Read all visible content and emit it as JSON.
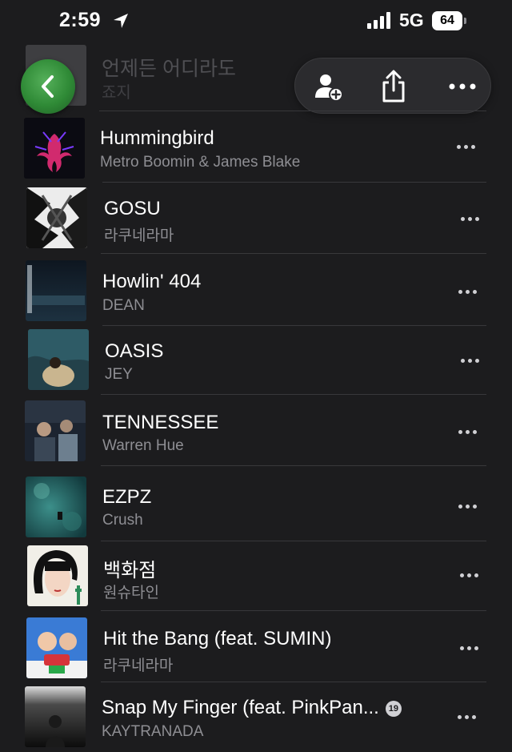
{
  "status_bar": {
    "time": "2:59",
    "network": "5G",
    "battery": "64"
  },
  "top_item": {
    "title": "언제든 어디라도",
    "artist": "죠지"
  },
  "songs": [
    {
      "title": "Hummingbird",
      "artist": "Metro Boomin & James Blake"
    },
    {
      "title": "GOSU",
      "artist": "라쿠네라마"
    },
    {
      "title": "Howlin' 404",
      "artist": "DEAN"
    },
    {
      "title": "OASIS",
      "artist": "JEY"
    },
    {
      "title": "TENNESSEE",
      "artist": "Warren Hue"
    },
    {
      "title": "EZPZ",
      "artist": "Crush"
    },
    {
      "title": "백화점",
      "artist": "원슈타인"
    },
    {
      "title": "Hit the Bang (feat. SUMIN)",
      "artist": "라쿠네라마"
    },
    {
      "title": "Snap My Finger (feat. PinkPan...",
      "artist": "KAYTRANADA",
      "badge": "19"
    }
  ],
  "icons": {
    "back": "chevron-left-icon",
    "add_user": "person-add-icon",
    "share": "share-icon",
    "more": "ellipsis-icon"
  },
  "colors": {
    "background": "#1c1c1e",
    "secondary_text": "#8e8e93",
    "back_button": "#2f8a36"
  }
}
